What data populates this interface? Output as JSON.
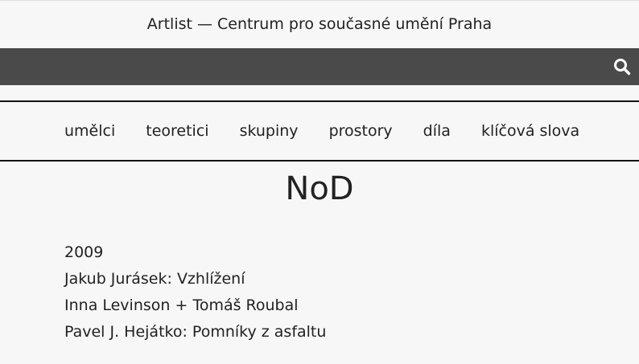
{
  "header": {
    "site_title": "Artlist — Centrum pro současné umění Praha",
    "search_icon": "search-icon"
  },
  "nav": {
    "items": [
      {
        "label": "umělci"
      },
      {
        "label": "teoretici"
      },
      {
        "label": "skupiny"
      },
      {
        "label": "prostory"
      },
      {
        "label": "díla"
      },
      {
        "label": "klíčová slova"
      }
    ]
  },
  "main": {
    "title": "NoD",
    "entries": [
      {
        "text": "2009"
      },
      {
        "text": "Jakub Jurásek: Vzhlížení"
      },
      {
        "text": "Inna Levinson + Tomáš Roubal"
      },
      {
        "text": "Pavel J. Hejátko: Pomníky z asfaltu"
      }
    ]
  },
  "colors": {
    "background": "#f7f7f7",
    "search_bar": "#4a4a4a",
    "text": "#222222"
  }
}
